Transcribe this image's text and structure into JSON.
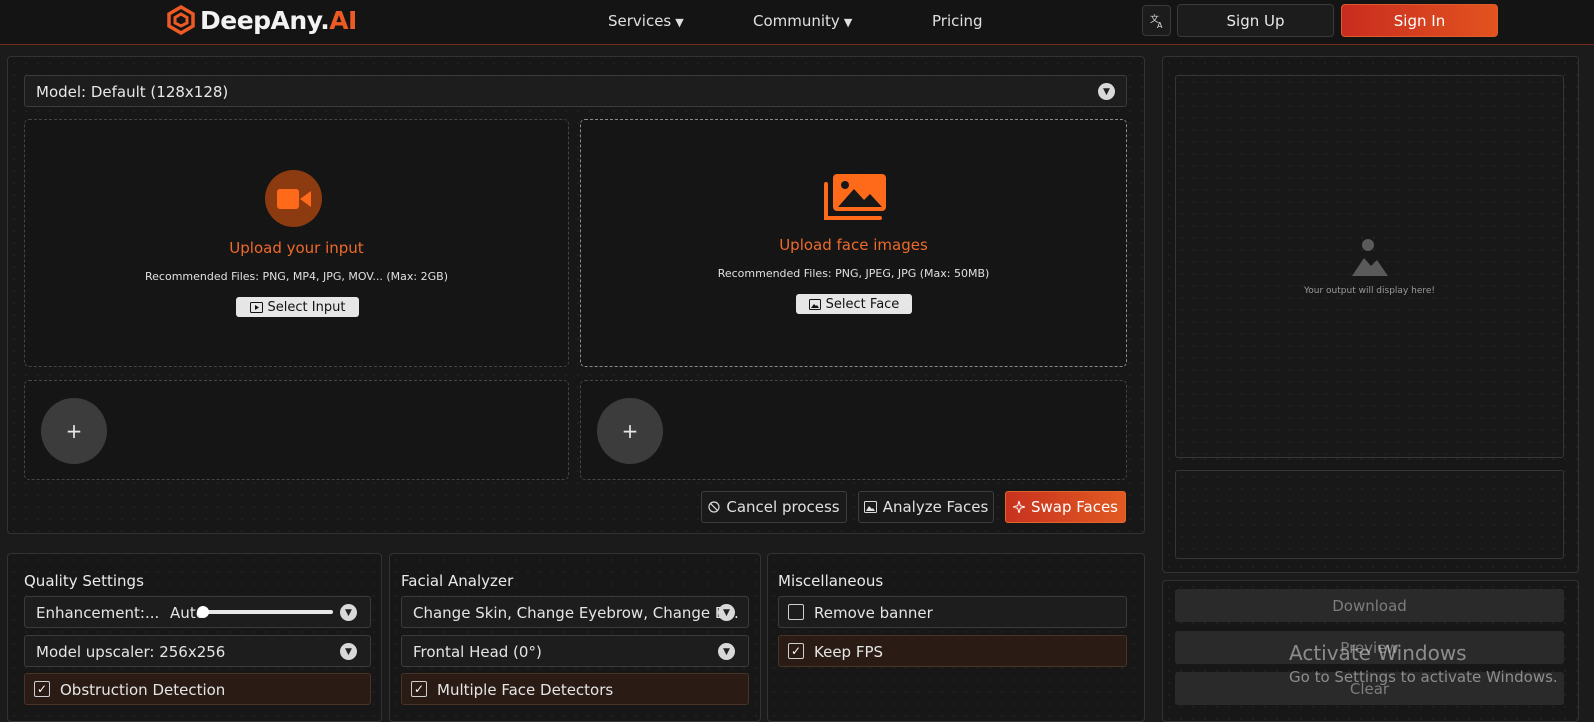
{
  "header": {
    "logo_prefix": "DeepAny.",
    "logo_suffix": "AI",
    "nav": [
      {
        "label": "Services",
        "has_caret": true
      },
      {
        "label": "Community",
        "has_caret": true
      },
      {
        "label": "Pricing",
        "has_caret": false
      }
    ],
    "caret": "▼",
    "language_icon": "translate-icon",
    "signup_label": "Sign Up",
    "signin_label": "Sign In"
  },
  "main": {
    "model_select": "Model: Default (128x128)",
    "input_zone": {
      "title": "Upload your input",
      "subtitle": "Recommended Files: PNG, MP4, JPG, MOV... (Max: 2GB)",
      "button": "Select Input",
      "icon": "video-camera-icon"
    },
    "face_zone": {
      "title": "Upload face images",
      "subtitle": "Recommended Files: PNG, JPEG, JPG (Max: 50MB)",
      "button": "Select Face",
      "icon": "image-stack-icon"
    },
    "add_symbol": "+",
    "actions": {
      "cancel": "Cancel process",
      "analyze": "Analyze Faces",
      "swap": "Swap Faces"
    }
  },
  "settings": {
    "quality": {
      "title": "Quality Settings",
      "enhancement_label": "Enhancement:...",
      "enhancement_value": "Auto",
      "enhancement_level": 0.04,
      "upscaler": "Model upscaler: 256x256",
      "obstruction": {
        "label": "Obstruction Detection",
        "checked": true
      }
    },
    "facial": {
      "title": "Facial Analyzer",
      "changes": "Change Skin, Change Eyebrow, Change E...",
      "head": "Frontal Head (0°)",
      "multi": {
        "label": "Multiple Face Detectors",
        "checked": true
      }
    },
    "misc": {
      "title": "Miscellaneous",
      "remove_banner": {
        "label": "Remove banner",
        "checked": false
      },
      "keep_fps": {
        "label": "Keep FPS",
        "checked": true
      }
    },
    "check_mark": "✓"
  },
  "output": {
    "placeholder": "Your output will display here!",
    "download": "Download",
    "preview": "Preview",
    "clear": "Clear"
  },
  "watermark": {
    "line1": "Activate Windows",
    "line2": "Go to Settings to activate Windows."
  },
  "colors": {
    "accent": "#ee5a24",
    "header_border": "#7a2a1c",
    "background": "#1b1b1b"
  }
}
